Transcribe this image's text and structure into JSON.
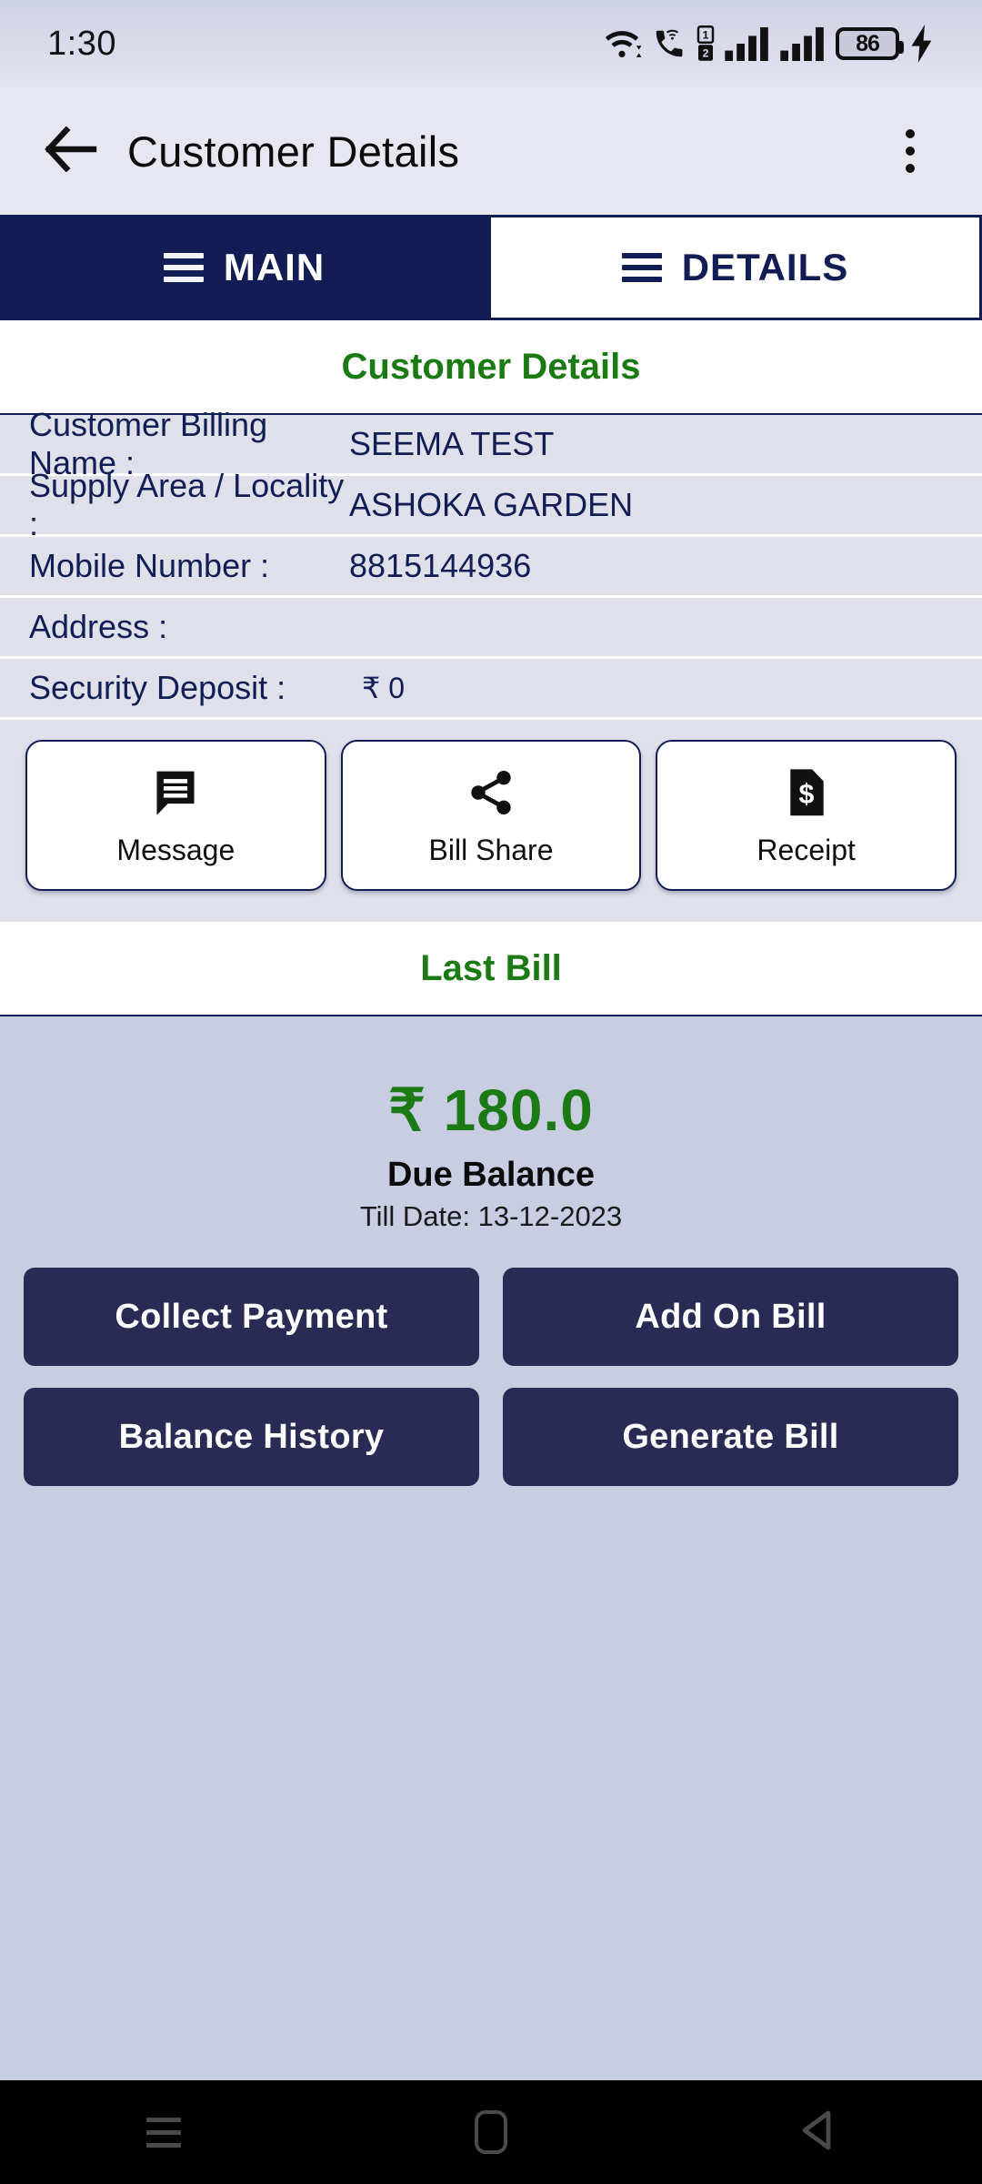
{
  "status_bar": {
    "time": "1:30",
    "battery_percent": "86",
    "icons": [
      "wifi-icon",
      "vowifi-call-icon",
      "dual-sim-indicator",
      "signal-bars-sim1-icon",
      "signal-bars-sim2-icon",
      "battery-icon",
      "charging-bolt-icon"
    ]
  },
  "app_bar": {
    "back_icon": "back-arrow-icon",
    "title": "Customer Details",
    "overflow_icon": "more-vertical-icon"
  },
  "tabs": [
    {
      "label": "MAIN",
      "icon": "hamburger-icon",
      "active": true
    },
    {
      "label": "DETAILS",
      "icon": "hamburger-icon",
      "active": false
    }
  ],
  "customer_section": {
    "heading": "Customer Details",
    "rows": [
      {
        "label": "Customer Billing Name :",
        "value": "SEEMA TEST"
      },
      {
        "label": "Supply Area / Locality :",
        "value": "ASHOKA GARDEN"
      },
      {
        "label": "Mobile Number :",
        "value": "8815144936"
      },
      {
        "label": "Address :",
        "value": ""
      },
      {
        "label": "Security Deposit :",
        "value": "₹ 0"
      }
    ]
  },
  "action_cards": [
    {
      "label": "Message",
      "icon": "message-bubble-icon"
    },
    {
      "label": "Bill Share",
      "icon": "share-icon"
    },
    {
      "label": "Receipt",
      "icon": "receipt-dollar-icon"
    }
  ],
  "last_bill": {
    "heading": "Last Bill",
    "amount": "₹ 180.0",
    "due_label": "Due Balance",
    "till_date": "Till Date: 13-12-2023",
    "buttons": [
      {
        "label": "Collect Payment"
      },
      {
        "label": "Add On Bill"
      },
      {
        "label": "Balance History"
      },
      {
        "label": "Generate Bill"
      }
    ]
  },
  "nav_bar": {
    "recents_icon": "recents-icon",
    "home_icon": "home-icon",
    "back_icon": "back-triangle-icon"
  },
  "colors": {
    "navy": "#121C55",
    "button_navy": "#2A2B55",
    "green": "#1C7A14",
    "row_bg": "#DFE0EA",
    "page_bg": "#C9CDE2",
    "appbar_bg": "#E6E7F0"
  }
}
